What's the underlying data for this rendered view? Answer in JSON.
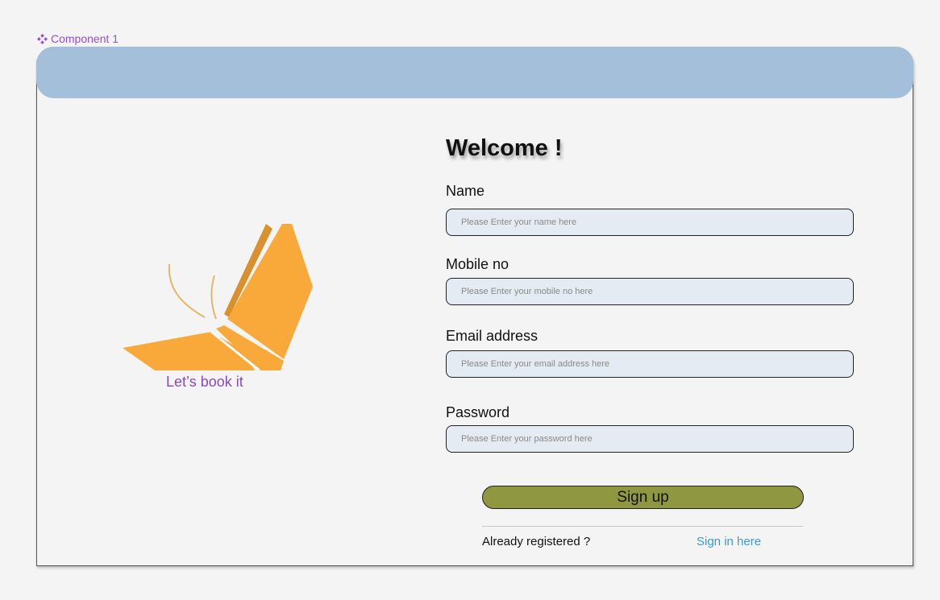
{
  "component_label": "Component 1",
  "accent_colors": {
    "component": "#9b4dd6",
    "header": "#a3bfd9",
    "logo": "#f9a93a",
    "tagline": "#8a4bb8",
    "signup_button": "#8f9740",
    "link": "#3a9ad9"
  },
  "brand": {
    "tagline": "Let’s book it",
    "logo_icon": "butterfly-book-logo"
  },
  "form": {
    "title": "Welcome !",
    "fields": [
      {
        "label": "Name",
        "placeholder": "Please Enter your name here",
        "value": ""
      },
      {
        "label": "Mobile no",
        "placeholder": "Please Enter your mobile no here",
        "value": ""
      },
      {
        "label": "Email address",
        "placeholder": "Please Enter your email address here",
        "value": ""
      },
      {
        "label": "Password",
        "placeholder": "Please Enter your password here",
        "value": ""
      }
    ],
    "submit_label": "Sign up",
    "already_text": "Already registered ?",
    "signin_link": "Sign in here"
  }
}
